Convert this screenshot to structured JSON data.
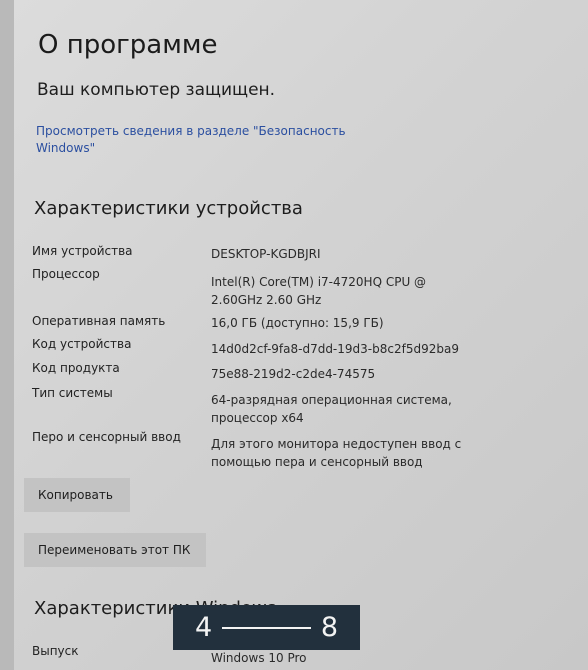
{
  "page": {
    "title": "О программе",
    "status": "Ваш компьютер защищен.",
    "security_link": "Просмотреть сведения в разделе \"Безопасность Windows\""
  },
  "device_specs": {
    "title": "Характеристики устройства",
    "rows": [
      {
        "label": "Имя устройства",
        "value": "DESKTOP-KGDBJRI"
      },
      {
        "label": "Процессор",
        "value": "Intel(R) Core(TM) i7-4720HQ CPU @ 2.60GHz   2.60 GHz"
      },
      {
        "label": "Оперативная память",
        "value": "16,0 ГБ (доступно: 15,9 ГБ)"
      },
      {
        "label": "Код устройства",
        "value": "14d0d2cf-9fa8-d7dd-19d3-b8c2f5d92ba9"
      },
      {
        "label": "Код продукта",
        "value": "75e88-219d2-c2de4-74575"
      },
      {
        "label": "Тип системы",
        "value": "64-разрядная операционная система, процессор x64"
      },
      {
        "label": "Перо и сенсорный ввод",
        "value": "Для этого монитора недоступен ввод с помощью пера и сенсорный ввод"
      }
    ],
    "copy_button": "Копировать",
    "rename_button": "Переименовать этот ПК"
  },
  "windows_specs": {
    "title": "Характеристики Windows",
    "rows": [
      {
        "label": "Выпуск",
        "value": "Windows 10 Pro"
      }
    ]
  },
  "image_counter": {
    "current": "4",
    "total": "8"
  }
}
